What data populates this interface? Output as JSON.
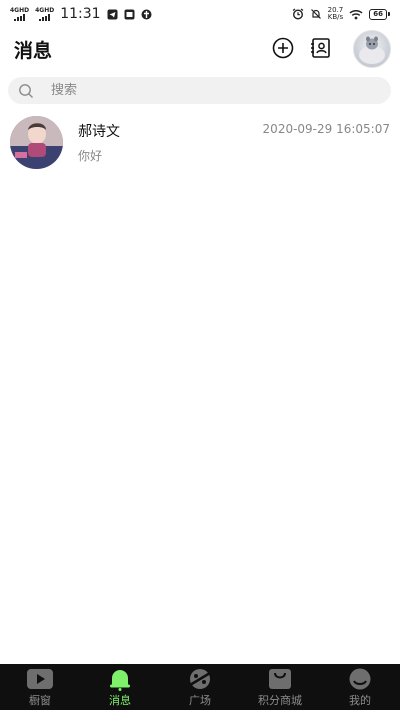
{
  "status_bar": {
    "network_1": "4GHD",
    "network_2": "4GHD",
    "time": "11:31",
    "speed_value": "20.7",
    "speed_unit": "KB/s",
    "battery": "66"
  },
  "header": {
    "title": "消息"
  },
  "search": {
    "placeholder": "搜索"
  },
  "conversations": [
    {
      "name": "郝诗文",
      "time": "2020-09-29 16:05:07",
      "preview": "你好"
    }
  ],
  "bottom_nav": {
    "items": [
      {
        "label": "橱窗",
        "icon": "play-icon",
        "active": false
      },
      {
        "label": "消息",
        "icon": "bell-icon",
        "active": true
      },
      {
        "label": "广场",
        "icon": "plaza-icon",
        "active": false
      },
      {
        "label": "积分商城",
        "icon": "shopping-bag-icon",
        "active": false
      },
      {
        "label": "我的",
        "icon": "smile-icon",
        "active": false
      }
    ]
  },
  "colors": {
    "accent": "#7ff06a",
    "nav_background": "#0f0f0f",
    "inactive": "#8c8c8c",
    "search_background": "#f1f1f1"
  }
}
